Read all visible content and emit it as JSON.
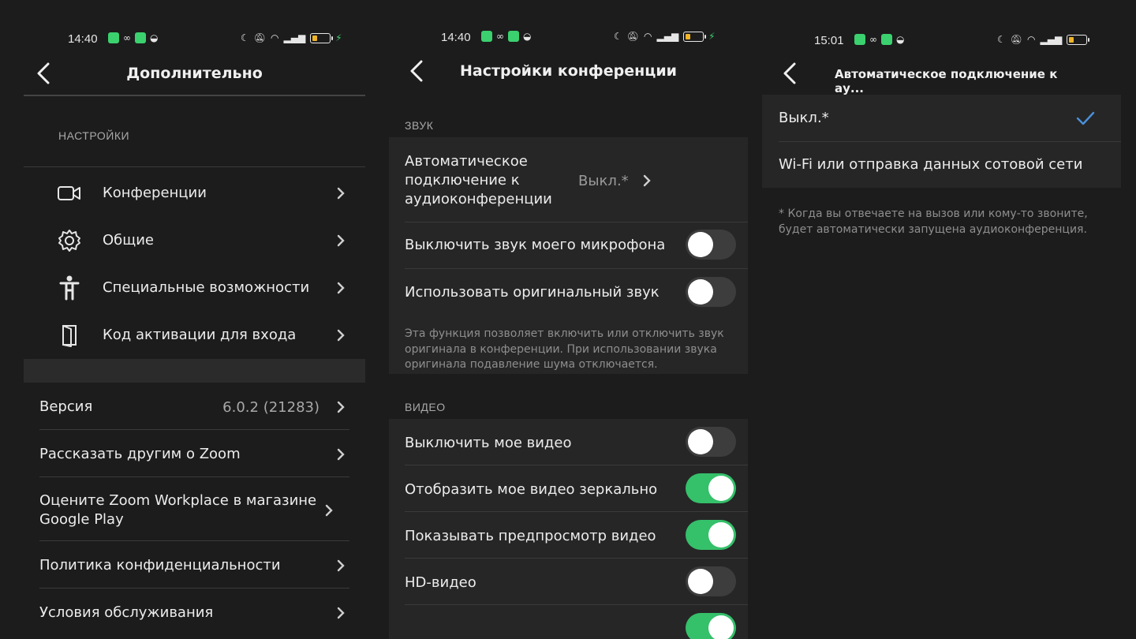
{
  "status_bars": [
    {
      "time": "14:40"
    },
    {
      "time": "14:40"
    },
    {
      "time": "15:01"
    }
  ],
  "panel1": {
    "title": "Дополнительно",
    "section_label": "НАСТРОЙКИ",
    "settings_items": [
      {
        "label": "Конференции",
        "icon": "video-camera-icon"
      },
      {
        "label": "Общие",
        "icon": "gear-icon"
      },
      {
        "label": "Специальные возможности",
        "icon": "accessibility-icon"
      },
      {
        "label": "Код активации для входа",
        "icon": "door-icon"
      }
    ],
    "version_label": "Версия",
    "version_value": "6.0.2 (21283)",
    "about_items": [
      {
        "label": "Рассказать другим о Zoom"
      },
      {
        "label": "Оцените Zoom Workplace в магазине Google Play"
      },
      {
        "label": "Политика конфиденциальности"
      },
      {
        "label": "Условия обслуживания"
      }
    ]
  },
  "panel2": {
    "title": "Настройки конференции",
    "audio_section": "ЗВУК",
    "auto_connect_label": "Автоматическое подключение к аудиоконференции",
    "auto_connect_value": "Выкл.*",
    "audio_toggles": [
      {
        "label": "Выключить звук моего микрофона",
        "on": false
      },
      {
        "label": "Использовать оригинальный звук",
        "on": false
      }
    ],
    "original_sound_desc": "Эта функция позволяет включить или отключить звук оригинала в конференции. При использовании звука оригинала подавление шума отключается.",
    "video_section": "ВИДЕО",
    "video_toggles": [
      {
        "label": "Выключить мое видео",
        "on": false
      },
      {
        "label": "Отобразить мое видео зеркально",
        "on": true
      },
      {
        "label": "Показывать предпросмотр видео",
        "on": true
      },
      {
        "label": "HD-видео",
        "on": false
      }
    ]
  },
  "panel3": {
    "title": "Автоматическое подключение к ау...",
    "options": [
      {
        "label": "Выкл.*",
        "selected": true
      },
      {
        "label": "Wi-Fi или отправка данных сотовой сети",
        "selected": false
      }
    ],
    "footnote": "* Когда вы отвечаете на вызов или кому-то звоните, будет автоматически запущена аудиоконференция."
  },
  "colors": {
    "background": "#1c1c1c",
    "group_background": "#262626",
    "toggle_on": "#35c06a",
    "toggle_off": "#3d3d3d",
    "check_accent": "#4a90d9",
    "secondary_text": "#8e8e8e"
  }
}
